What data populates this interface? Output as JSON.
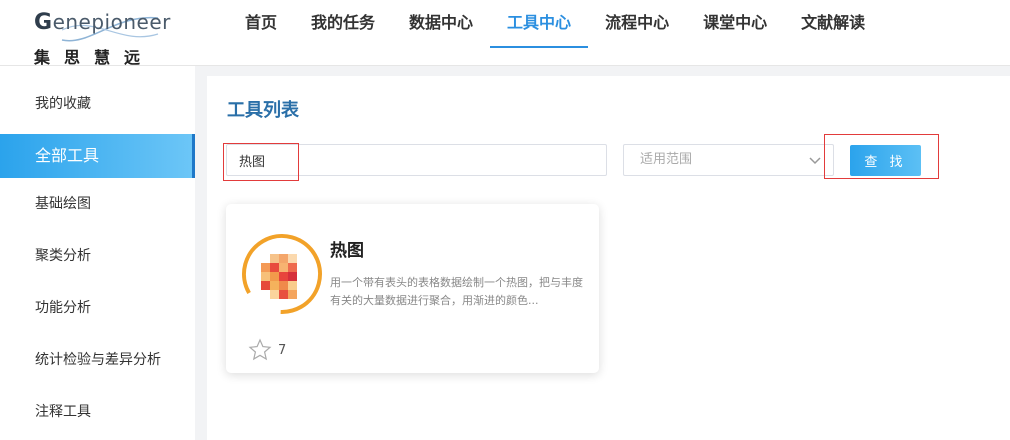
{
  "header": {
    "logo_word_first": "G",
    "logo_word_rest": "enepioneer",
    "logo_cn": "集思慧远",
    "nav": [
      {
        "label": "首页"
      },
      {
        "label": "我的任务"
      },
      {
        "label": "数据中心"
      },
      {
        "label": "工具中心",
        "active": true
      },
      {
        "label": "流程中心"
      },
      {
        "label": "课堂中心"
      },
      {
        "label": "文献解读"
      }
    ]
  },
  "sidebar": {
    "items": [
      {
        "label": "我的收藏"
      },
      {
        "label": "全部工具",
        "active": true
      },
      {
        "label": "基础绘图"
      },
      {
        "label": "聚类分析"
      },
      {
        "label": "功能分析"
      },
      {
        "label": "统计检验与差异分析"
      },
      {
        "label": "注释工具"
      }
    ]
  },
  "main": {
    "title": "工具列表",
    "search_value": "热图",
    "scope_placeholder": "适用范围",
    "search_button": "查 找"
  },
  "card": {
    "title": "热图",
    "description": "用一个带有表头的表格数据绘制一个热图，把与丰度有关的大量数据进行聚合，用渐进的颜色...",
    "stars": "7",
    "icon": "heatmap-icon"
  },
  "colors": {
    "accent": "#2b8fe0",
    "title_blue": "#2a6fa8",
    "highlight_red": "#e23b3b",
    "ring_orange": "#f2a229"
  }
}
